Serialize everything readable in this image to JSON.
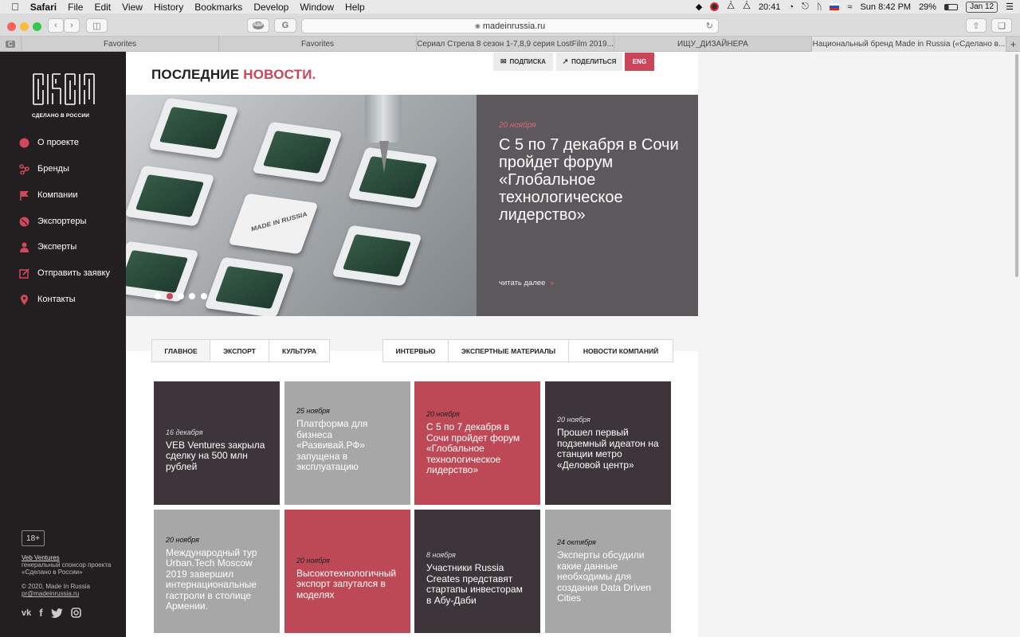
{
  "menubar": {
    "app": "Safari",
    "items": [
      "File",
      "Edit",
      "View",
      "History",
      "Bookmarks",
      "Develop",
      "Window",
      "Help"
    ],
    "clock": "20:41",
    "datetime": "Sun 8:42 PM",
    "battery": "29%",
    "date_badge": "Jan 12"
  },
  "toolbar": {
    "url": "madeinrussia.ru",
    "abp": "ABP",
    "g": "G"
  },
  "tabs": [
    "Favorites",
    "Favorites",
    "Сериал Стрела 8 сезон 1-7,8,9 серия LostFilm 2019...",
    "ИЩУ_ДИЗАЙНЕРА",
    "Национальный бренд Made in Russia («Сделано в..."
  ],
  "tab_c": "C",
  "sidebar": {
    "logo_caption": "СДЕЛАНО В РОССИИ",
    "nav": [
      {
        "label": "О проекте",
        "icon": "info-circle-icon"
      },
      {
        "label": "Бренды",
        "icon": "share-nodes-icon"
      },
      {
        "label": "Компании",
        "icon": "flag-icon"
      },
      {
        "label": "Экспортеры",
        "icon": "globe-icon"
      },
      {
        "label": "Эксперты",
        "icon": "person-icon"
      },
      {
        "label": "Отправить заявку",
        "icon": "edit-icon"
      },
      {
        "label": "Контакты",
        "icon": "map-pin-icon"
      }
    ],
    "age": "18+",
    "sponsor_link": "Veb Ventures",
    "sponsor_text_1": "генеральный спонсор проекта",
    "sponsor_text_2": "«Сделано в России»",
    "copyright": "© 2020, Made In Russia",
    "email": "pr@madeinrussia.ru",
    "social": {
      "vk": "vk",
      "fb": "f",
      "tw": "twitter",
      "ig": "instagram"
    }
  },
  "header": {
    "title_a": "ПОСЛЕДНИЕ",
    "title_b": "НОВОСТИ.",
    "subscribe": "ПОДПИСКА",
    "share": "ПОДЕЛИТЬСЯ",
    "lang": "ENG"
  },
  "hero": {
    "stamp": "MADE IN RUSSIA",
    "date": "20 ноября",
    "headline": "С 5 по 7 декабря в Сочи пройдет форум «Глобальное технологическое лидерство»",
    "more": "читать далее",
    "more_arrow": "»",
    "slides": 5,
    "active_slide": 2
  },
  "filters_left": [
    "ГЛАВНОЕ",
    "ЭКСПОРТ",
    "КУЛЬТУРА"
  ],
  "filters_right": [
    "ИНТЕРВЬЮ",
    "ЭКСПЕРТНЫЕ МАТЕРИАЛЫ",
    "НОВОСТИ КОМПАНИЙ"
  ],
  "news": [
    {
      "date": "16 декабря",
      "title": "VEB Ventures закрыла сделку на 500 млн рублей",
      "style": "dark"
    },
    {
      "date": "25 ноября",
      "title": "Платформа для бизнеса «Развивай.РФ» запущена в эксплуатацию",
      "style": "grey"
    },
    {
      "date": "20 ноября",
      "title": "С 5 по 7 декабря в Сочи пройдет форум «Глобальное технологическое лидерство»",
      "style": "red"
    },
    {
      "date": "20 ноября",
      "title": "Прошел первый подземный идеатон на станции метро «Деловой центр»",
      "style": "dark"
    },
    {
      "date": "20 ноября",
      "title": "Международный тур Urban.Tech Moscow 2019 завершил интернациональные гастроли в столице Армении.",
      "style": "grey"
    },
    {
      "date": "20 ноября",
      "title": "Высокотехнологичный экспорт запутался в моделях",
      "style": "red"
    },
    {
      "date": "8 ноября",
      "title": "Участники Russia Creates представят стартапы инвесторам в Абу-Даби",
      "style": "dark"
    },
    {
      "date": "24 октября",
      "title": "Эксперты обсудили какие данные необходимы для создания Data Driven Cities",
      "style": "grey"
    }
  ]
}
